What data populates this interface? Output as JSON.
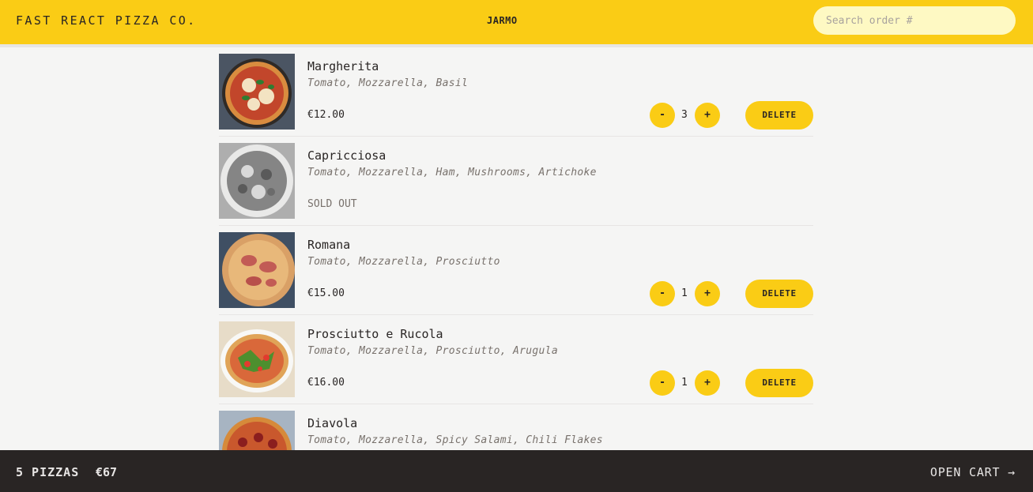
{
  "header": {
    "logo": "FAST REACT PIZZA CO.",
    "username": "JARMO",
    "search_placeholder": "Search order #"
  },
  "menu": {
    "items": [
      {
        "name": "Margherita",
        "ingredients": "Tomato, Mozzarella, Basil",
        "price": "€12.00",
        "qty": "3",
        "minus": "-",
        "plus": "+",
        "delete": "DELETE",
        "image": "pizza-margherita"
      },
      {
        "name": "Capricciosa",
        "ingredients": "Tomato, Mozzarella, Ham, Mushrooms, Artichoke",
        "status": "SOLD OUT",
        "image": "pizza-capricciosa"
      },
      {
        "name": "Romana",
        "ingredients": "Tomato, Mozzarella, Prosciutto",
        "price": "€15.00",
        "qty": "1",
        "minus": "-",
        "plus": "+",
        "delete": "DELETE",
        "image": "pizza-romana"
      },
      {
        "name": "Prosciutto e Rucola",
        "ingredients": "Tomato, Mozzarella, Prosciutto, Arugula",
        "price": "€16.00",
        "qty": "1",
        "minus": "-",
        "plus": "+",
        "delete": "DELETE",
        "image": "pizza-prosciutto-rucola"
      },
      {
        "name": "Diavola",
        "ingredients": "Tomato, Mozzarella, Spicy Salami, Chili Flakes",
        "image": "pizza-diavola"
      }
    ]
  },
  "cart_bar": {
    "count": "5 PIZZAS",
    "total": "€67",
    "open_cart": "OPEN CART →"
  },
  "colors": {
    "accent": "#facc15",
    "footer": "#292524",
    "background": "#f5f5f4"
  }
}
